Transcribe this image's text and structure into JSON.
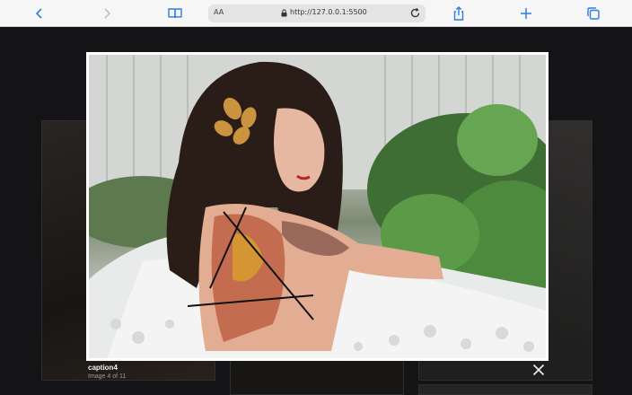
{
  "browser": {
    "reader_label": "AA",
    "url": "http://127.0.0.1:5500"
  },
  "icons": {
    "back": "chevron-left-icon",
    "forward": "chevron-right-icon",
    "bookmarks": "book-icon",
    "lock": "lock-icon",
    "reload": "reload-icon",
    "share": "share-icon",
    "new_tab": "plus-icon",
    "tabs": "tabs-icon",
    "close": "close-icon"
  },
  "lightbox": {
    "caption": "caption4",
    "counter": "Image 4 of 11"
  },
  "colors": {
    "accent": "#2f7de1",
    "overlay": "#1d1d1f"
  }
}
